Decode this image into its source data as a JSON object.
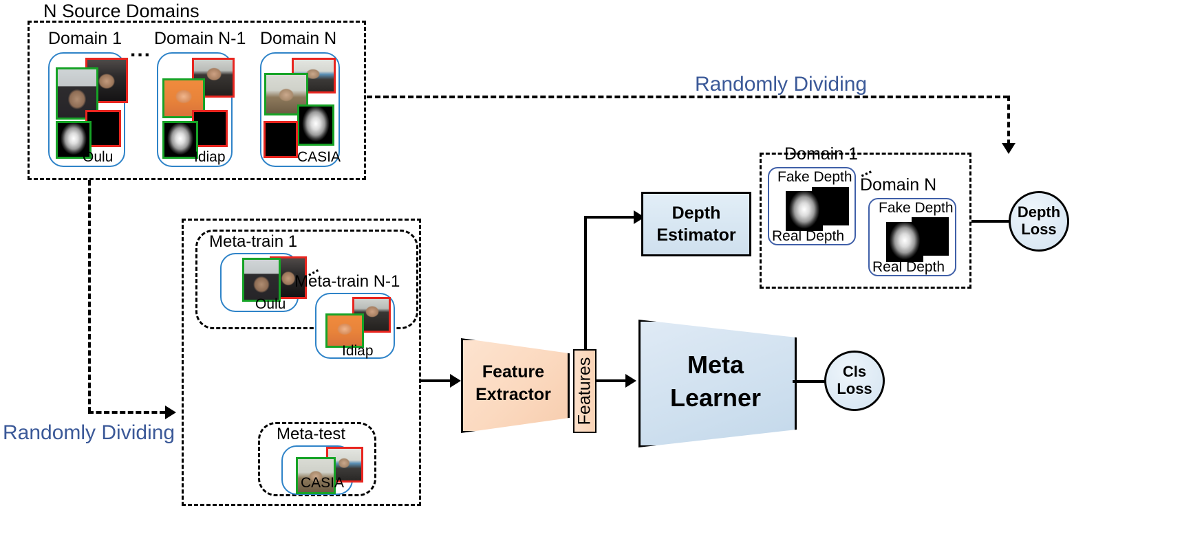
{
  "figure": {
    "caption_top": "N Source Domains"
  },
  "source_panel": {
    "title": "N Source Domains",
    "ellipsis": "...",
    "domains": [
      {
        "title": "Domain 1",
        "dataset": "Oulu"
      },
      {
        "title": "Domain N-1",
        "dataset": "Idiap"
      },
      {
        "title": "Domain N",
        "dataset": "CASIA"
      }
    ]
  },
  "arrows": {
    "randomly_dividing_top": "Randomly Dividing",
    "randomly_dividing_left": "Randomly Dividing"
  },
  "meta_panel": {
    "ellipsis": "...",
    "meta_train": [
      {
        "title": "Meta-train 1",
        "dataset": "Oulu"
      },
      {
        "title": "Meta-train N-1",
        "dataset": "Idiap"
      }
    ],
    "meta_test": {
      "title": "Meta-test",
      "dataset": "CASIA"
    }
  },
  "blocks": {
    "feature_extractor": {
      "line1": "Feature",
      "line2": "Extractor"
    },
    "features_bar": {
      "label": "Features"
    },
    "depth_estimator": {
      "line1": "Depth",
      "line2": "Estimator"
    },
    "meta_learner": {
      "line1": "Meta",
      "line2": "Learner"
    }
  },
  "depth_panel": {
    "ellipsis": "...",
    "domains": [
      {
        "title": "Domain 1",
        "fake": "Fake Depth",
        "real": "Real Depth"
      },
      {
        "title": "Domain N",
        "fake": "Fake Depth",
        "real": "Real Depth"
      }
    ]
  },
  "losses": {
    "depth_loss": {
      "line1": "Depth",
      "line2": "Loss"
    },
    "cls_loss": {
      "line1": "Cls",
      "line2": "Loss"
    }
  },
  "colors": {
    "accent_blue_text": "#3B5998",
    "group_border_blue": "#2E83C8",
    "real_sample_border": "#16A326",
    "fake_sample_border": "#E8251F",
    "extractor_fill": "#FBD9BF",
    "learner_fill": "#CFE0EF"
  }
}
